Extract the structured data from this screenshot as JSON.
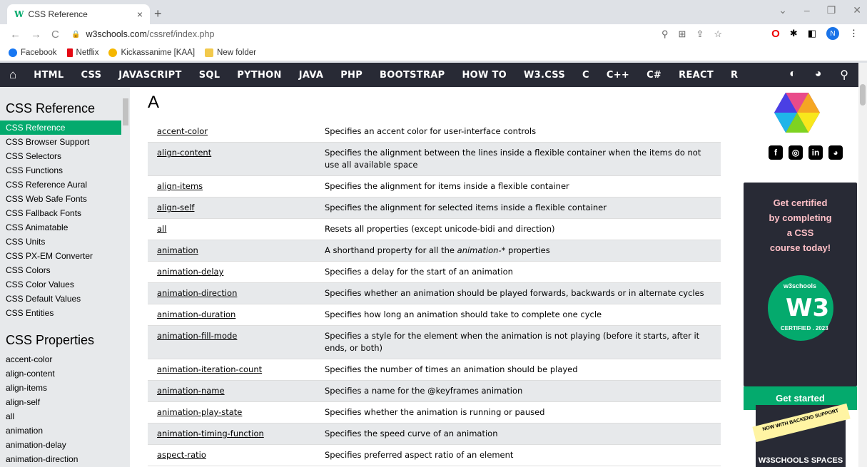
{
  "browser": {
    "tab_title": "CSS Reference",
    "tab_favicon": "W",
    "url_host": "w3schools.com",
    "url_path": "/cssref/index.php",
    "profile_initial": "N",
    "bookmarks": [
      {
        "label": "Facebook",
        "color": "#1877f2"
      },
      {
        "label": "Netflix",
        "color": "#e50914"
      },
      {
        "label": "Kickassanime [KAA]",
        "color": "#f5b700"
      },
      {
        "label": "New folder",
        "color": "#f2c94c"
      }
    ]
  },
  "topnav": {
    "links": [
      "HTML",
      "CSS",
      "JAVASCRIPT",
      "SQL",
      "PYTHON",
      "JAVA",
      "PHP",
      "BOOTSTRAP",
      "HOW TO",
      "W3.CSS",
      "C",
      "C++",
      "C#",
      "REACT",
      "R"
    ]
  },
  "sidebar": {
    "heading1": "CSS Reference",
    "ref_items": [
      "CSS Reference",
      "CSS Browser Support",
      "CSS Selectors",
      "CSS Functions",
      "CSS Reference Aural",
      "CSS Web Safe Fonts",
      "CSS Fallback Fonts",
      "CSS Animatable",
      "CSS Units",
      "CSS PX-EM Converter",
      "CSS Colors",
      "CSS Color Values",
      "CSS Default Values",
      "CSS Entities"
    ],
    "heading2": "CSS Properties",
    "prop_items": [
      "accent-color",
      "align-content",
      "align-items",
      "align-self",
      "all",
      "animation",
      "animation-delay",
      "animation-direction"
    ]
  },
  "main": {
    "letter": "A",
    "rows": [
      {
        "prop": "accent-color",
        "desc": "Specifies an accent color for user-interface controls"
      },
      {
        "prop": "align-content",
        "desc": "Specifies the alignment between the lines inside a flexible container when the items do not use all available space"
      },
      {
        "prop": "align-items",
        "desc": "Specifies the alignment for items inside a flexible container"
      },
      {
        "prop": "align-self",
        "desc": "Specifies the alignment for selected items inside a flexible container"
      },
      {
        "prop": "all",
        "desc": "Resets all properties (except unicode-bidi and direction)"
      },
      {
        "prop": "animation",
        "desc_pre": "A shorthand property for all the ",
        "desc_em": "animation-*",
        "desc_post": " properties"
      },
      {
        "prop": "animation-delay",
        "desc": "Specifies a delay for the start of an animation"
      },
      {
        "prop": "animation-direction",
        "desc": "Specifies whether an animation should be played forwards, backwards or in alternate cycles"
      },
      {
        "prop": "animation-duration",
        "desc": "Specifies how long an animation should take to complete one cycle"
      },
      {
        "prop": "animation-fill-mode",
        "desc": "Specifies a style for the element when the animation is not playing (before it starts, after it ends, or both)"
      },
      {
        "prop": "animation-iteration-count",
        "desc": "Specifies the number of times an animation should be played"
      },
      {
        "prop": "animation-name",
        "desc": "Specifies a name for the @keyframes animation"
      },
      {
        "prop": "animation-play-state",
        "desc": "Specifies whether the animation is running or paused"
      },
      {
        "prop": "animation-timing-function",
        "desc": "Specifies the speed curve of an animation"
      },
      {
        "prop": "aspect-ratio",
        "desc": "Specifies preferred aspect ratio of an element"
      }
    ]
  },
  "ads": {
    "cert_lines": [
      "Get certified",
      "by completing",
      "a CSS",
      "course today!"
    ],
    "badge_top": "w3schools",
    "badge_mark": "W3",
    "badge_bottom": "CERTIFIED . 2023",
    "get_started": "Get started",
    "spaces_ribbon": "NOW WITH BACKEND SUPPORT",
    "spaces_title": "W3SCHOOLS SPACES"
  },
  "colors": {
    "brand_green": "#04aa6d",
    "nav_dark": "#282a35",
    "stripe": "#e7e9eb"
  }
}
